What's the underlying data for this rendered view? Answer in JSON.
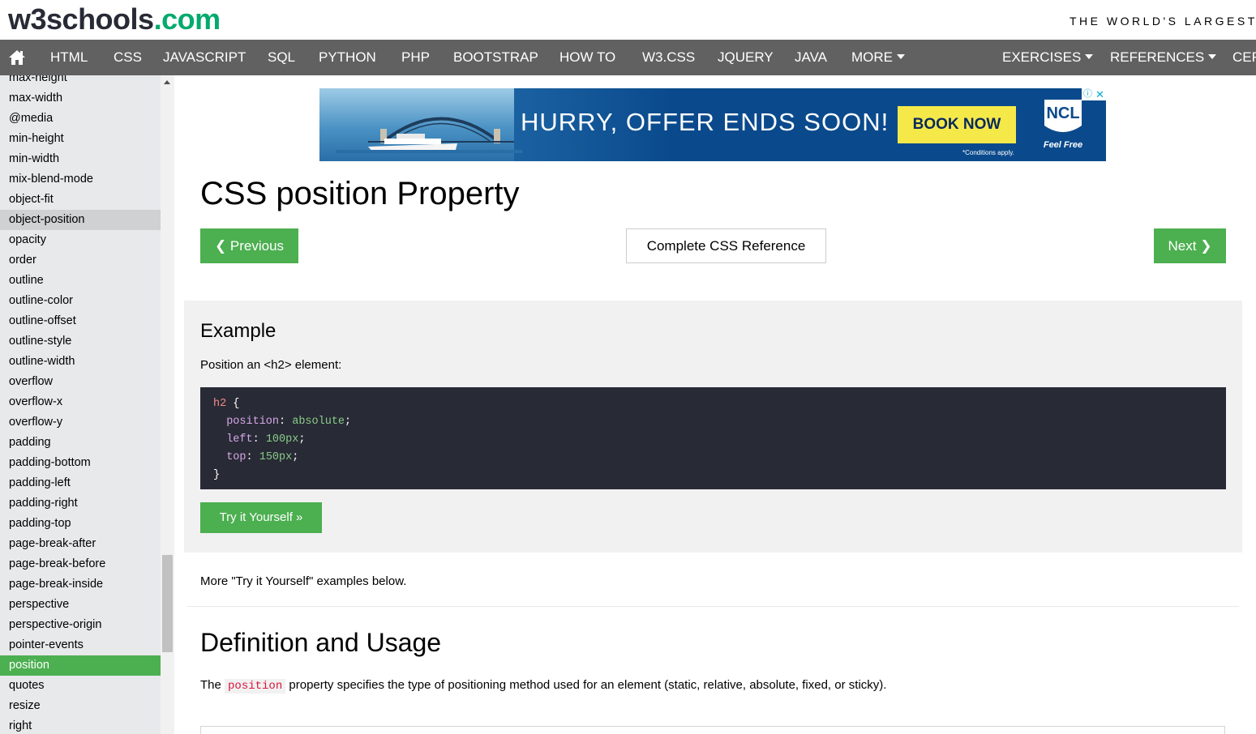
{
  "header": {
    "logo_main": "w3schools",
    "logo_suffix": ".com",
    "tagline": "THE WORLD'S LARGEST"
  },
  "nav": {
    "items": [
      "HTML",
      "CSS",
      "JAVASCRIPT",
      "SQL",
      "PYTHON",
      "PHP",
      "BOOTSTRAP",
      "HOW TO",
      "W3.CSS",
      "JQUERY",
      "JAVA",
      "MORE"
    ],
    "right_items": [
      "EXERCISES",
      "REFERENCES",
      "CER"
    ]
  },
  "sidebar": {
    "items": [
      "max-height",
      "max-width",
      "@media",
      "min-height",
      "min-width",
      "mix-blend-mode",
      "object-fit",
      "object-position",
      "opacity",
      "order",
      "outline",
      "outline-color",
      "outline-offset",
      "outline-style",
      "outline-width",
      "overflow",
      "overflow-x",
      "overflow-y",
      "padding",
      "padding-bottom",
      "padding-left",
      "padding-right",
      "padding-top",
      "page-break-after",
      "page-break-before",
      "page-break-inside",
      "perspective",
      "perspective-origin",
      "pointer-events",
      "position",
      "quotes",
      "resize",
      "right"
    ],
    "highlighted": "object-position",
    "active": "position"
  },
  "ad": {
    "headline": "HURRY, OFFER ENDS SOON!",
    "cta": "BOOK NOW",
    "conditions": "*Conditions apply.",
    "brand": "NCL",
    "brand_slogan": "Feel Free",
    "info_icon": "ⓘ",
    "close_icon": "✕"
  },
  "page": {
    "title": "CSS position Property",
    "prev_label": "❮ Previous",
    "ref_label": "Complete CSS Reference",
    "next_label": "Next ❯"
  },
  "example": {
    "title": "Example",
    "description": "Position an <h2> element:",
    "code": {
      "selector": "h2",
      "open": " {",
      "props": [
        {
          "name": "position",
          "value": "absolute"
        },
        {
          "name": "left",
          "value": "100px"
        },
        {
          "name": "top",
          "value": "150px"
        }
      ],
      "close": "}"
    },
    "try_label": "Try it Yourself »"
  },
  "more_text": "More \"Try it Yourself\" examples below.",
  "definition": {
    "title": "Definition and Usage",
    "text_before": "The ",
    "code_word": "position",
    "text_after": " property specifies the type of positioning method used for an element (static, relative, absolute, fixed, or sticky)."
  },
  "colors": {
    "nav_bg": "#616161",
    "green": "#4caf50",
    "sidebar_bg": "#e7e9eb",
    "code_bg": "#282a35"
  }
}
